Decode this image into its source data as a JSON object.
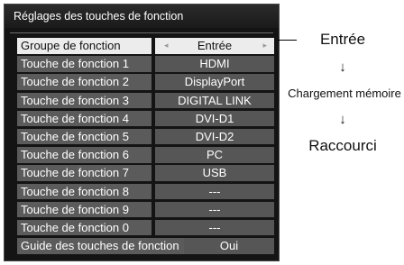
{
  "panel": {
    "title": "Réglages des touches de fonction",
    "rows": [
      {
        "label": "Groupe de fonction",
        "value": "Entrée",
        "selected": true
      },
      {
        "label": "Touche de fonction 1",
        "value": "HDMI"
      },
      {
        "label": "Touche de fonction 2",
        "value": "DisplayPort"
      },
      {
        "label": "Touche de fonction 3",
        "value": "DIGITAL LINK"
      },
      {
        "label": "Touche de fonction 4",
        "value": "DVI-D1"
      },
      {
        "label": "Touche de fonction 5",
        "value": "DVI-D2"
      },
      {
        "label": "Touche de fonction 6",
        "value": "PC"
      },
      {
        "label": "Touche de fonction 7",
        "value": "USB"
      },
      {
        "label": "Touche de fonction 8",
        "value": "---"
      },
      {
        "label": "Touche de fonction 9",
        "value": "---"
      },
      {
        "label": "Touche de fonction 0",
        "value": "---"
      },
      {
        "label": "Guide des touches de fonction",
        "value": "Oui"
      }
    ],
    "arrow_left": "◂",
    "arrow_right": "▸"
  },
  "annotation": {
    "option1": "Entrée",
    "down1": "↓",
    "option2": "Chargement mémoire",
    "down2": "↓",
    "option3": "Raccourci"
  }
}
